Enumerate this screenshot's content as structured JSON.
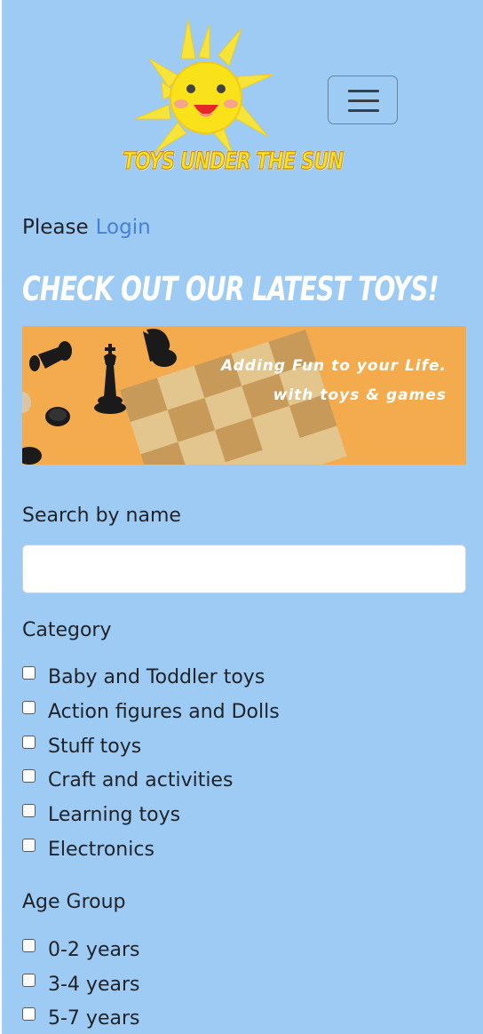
{
  "header": {
    "logo_text": "TOYS UNDER THE SUN",
    "menu_toggle_label": "Toggle navigation"
  },
  "login": {
    "prefix": "Please",
    "link_label": "Login"
  },
  "headline": "CHECK OUT OUR LATEST TOYS!",
  "banner": {
    "line1": "Adding Fun to your Life.",
    "line2": "with toys & games"
  },
  "search": {
    "label": "Search by name",
    "value": "",
    "placeholder": ""
  },
  "category": {
    "label": "Category",
    "items": [
      {
        "label": "Baby and Toddler toys",
        "checked": false
      },
      {
        "label": "Action figures and Dolls",
        "checked": false
      },
      {
        "label": "Stuff toys",
        "checked": false
      },
      {
        "label": "Craft and activities",
        "checked": false
      },
      {
        "label": "Learning toys",
        "checked": false
      },
      {
        "label": "Electronics",
        "checked": false
      }
    ]
  },
  "age_group": {
    "label": "Age Group",
    "items": [
      {
        "label": "0-2 years",
        "checked": false
      },
      {
        "label": "3-4 years",
        "checked": false
      },
      {
        "label": "5-7 years",
        "checked": false
      }
    ]
  },
  "colors": {
    "page_background": "#9ecbf4",
    "link": "#4a7fd8",
    "logo_yellow": "#f9e51c",
    "banner_orange": "#f2a94a"
  }
}
